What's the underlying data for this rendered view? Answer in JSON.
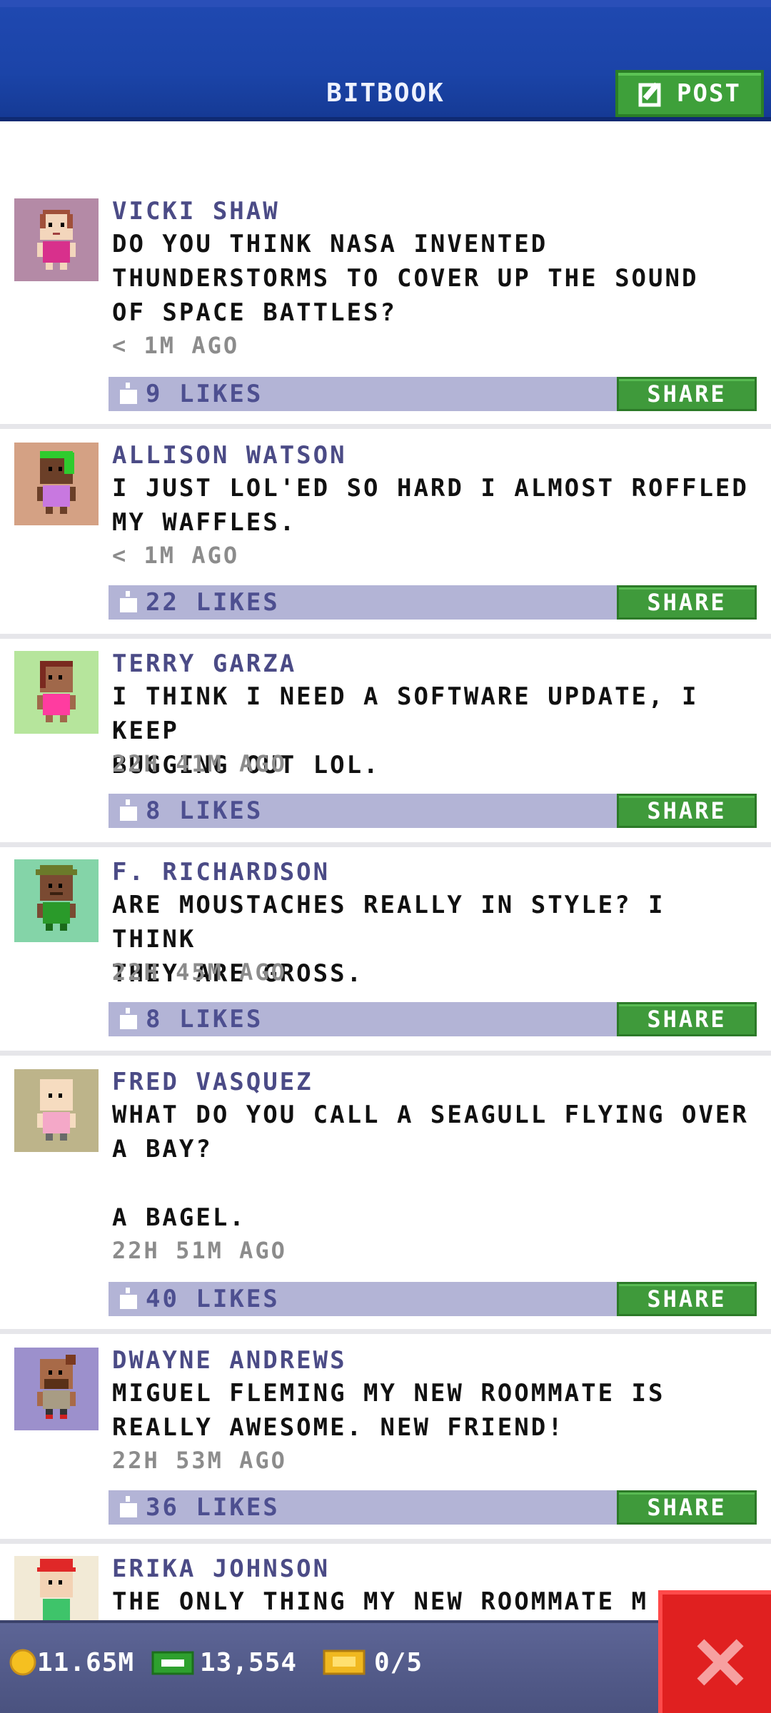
{
  "header": {
    "title": "BITBOOK",
    "post_label": "POST"
  },
  "posts": [
    {
      "author": "VICKI SHAW",
      "text": "DO YOU THINK NASA INVENTED\nTHUNDERSTORMS TO COVER UP THE SOUND\nOF SPACE BATTLES?",
      "time": "< 1M AGO",
      "likes": "9 LIKES",
      "share": "SHARE",
      "avatar_bg": "#b48aa6"
    },
    {
      "author": "ALLISON WATSON",
      "text": "I JUST LOL'ED SO HARD I ALMOST ROFFLED\nMY WAFFLES.",
      "time": "< 1M AGO",
      "likes": "22 LIKES",
      "share": "SHARE",
      "avatar_bg": "#d4a184"
    },
    {
      "author": "TERRY GARZA",
      "text": "I THINK I NEED A SOFTWARE UPDATE, I KEEP\nBUGGING OUT LOL.",
      "time": "22H 41M AGO",
      "likes": "8 LIKES",
      "share": "SHARE",
      "avatar_bg": "#b6e59c"
    },
    {
      "author": "F. RICHARDSON",
      "text": "ARE MOUSTACHES REALLY IN STYLE? I THINK\nTHEY ARE GROSS.",
      "time": "22H 45M AGO",
      "likes": "8 LIKES",
      "share": "SHARE",
      "avatar_bg": "#84d4a8"
    },
    {
      "author": "FRED VASQUEZ",
      "text": "WHAT DO YOU CALL A SEAGULL FLYING OVER\nA BAY?\n\nA BAGEL.",
      "time": "22H 51M AGO",
      "likes": "40 LIKES",
      "share": "SHARE",
      "avatar_bg": "#bdb48a"
    },
    {
      "author": "DWAYNE ANDREWS",
      "text": "MIGUEL FLEMING MY NEW ROOMMATE IS\nREALLY AWESOME. NEW FRIEND!",
      "time": "22H 53M AGO",
      "likes": "36 LIKES",
      "share": "SHARE",
      "avatar_bg": "#9c90cc"
    },
    {
      "author": "ERIKA JOHNSON",
      "text": "THE ONLY THING MY NEW ROOMMATE M",
      "time": "",
      "likes": "",
      "share": "",
      "avatar_bg": "#f2ead6"
    }
  ],
  "footer": {
    "coins": "11.65M",
    "bux": "13,554",
    "tickets": "0/5"
  },
  "colors": {
    "header_blue": "#1b44a8",
    "share_green": "#3f9a3b",
    "likes_bar": "#b3b4d6",
    "close_red": "#e02020"
  }
}
